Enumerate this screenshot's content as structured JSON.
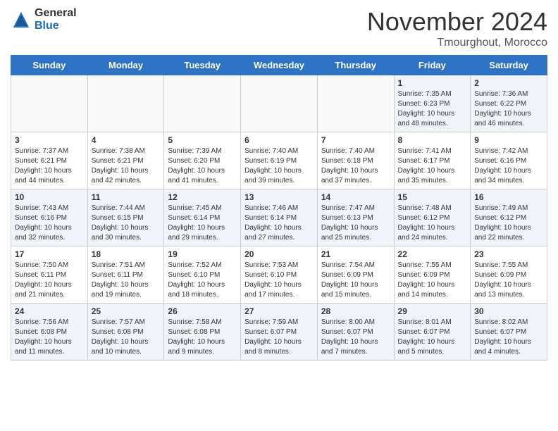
{
  "header": {
    "logo_general": "General",
    "logo_blue": "Blue",
    "month_title": "November 2024",
    "location": "Tmourghout, Morocco"
  },
  "days_of_week": [
    "Sunday",
    "Monday",
    "Tuesday",
    "Wednesday",
    "Thursday",
    "Friday",
    "Saturday"
  ],
  "weeks": [
    [
      {
        "day": "",
        "empty": true
      },
      {
        "day": "",
        "empty": true
      },
      {
        "day": "",
        "empty": true
      },
      {
        "day": "",
        "empty": true
      },
      {
        "day": "",
        "empty": true
      },
      {
        "day": "1",
        "sunrise": "7:35 AM",
        "sunset": "6:23 PM",
        "daylight": "10 hours and 48 minutes."
      },
      {
        "day": "2",
        "sunrise": "7:36 AM",
        "sunset": "6:22 PM",
        "daylight": "10 hours and 46 minutes."
      }
    ],
    [
      {
        "day": "3",
        "sunrise": "7:37 AM",
        "sunset": "6:21 PM",
        "daylight": "10 hours and 44 minutes."
      },
      {
        "day": "4",
        "sunrise": "7:38 AM",
        "sunset": "6:21 PM",
        "daylight": "10 hours and 42 minutes."
      },
      {
        "day": "5",
        "sunrise": "7:39 AM",
        "sunset": "6:20 PM",
        "daylight": "10 hours and 41 minutes."
      },
      {
        "day": "6",
        "sunrise": "7:40 AM",
        "sunset": "6:19 PM",
        "daylight": "10 hours and 39 minutes."
      },
      {
        "day": "7",
        "sunrise": "7:40 AM",
        "sunset": "6:18 PM",
        "daylight": "10 hours and 37 minutes."
      },
      {
        "day": "8",
        "sunrise": "7:41 AM",
        "sunset": "6:17 PM",
        "daylight": "10 hours and 35 minutes."
      },
      {
        "day": "9",
        "sunrise": "7:42 AM",
        "sunset": "6:16 PM",
        "daylight": "10 hours and 34 minutes."
      }
    ],
    [
      {
        "day": "10",
        "sunrise": "7:43 AM",
        "sunset": "6:16 PM",
        "daylight": "10 hours and 32 minutes."
      },
      {
        "day": "11",
        "sunrise": "7:44 AM",
        "sunset": "6:15 PM",
        "daylight": "10 hours and 30 minutes."
      },
      {
        "day": "12",
        "sunrise": "7:45 AM",
        "sunset": "6:14 PM",
        "daylight": "10 hours and 29 minutes."
      },
      {
        "day": "13",
        "sunrise": "7:46 AM",
        "sunset": "6:14 PM",
        "daylight": "10 hours and 27 minutes."
      },
      {
        "day": "14",
        "sunrise": "7:47 AM",
        "sunset": "6:13 PM",
        "daylight": "10 hours and 25 minutes."
      },
      {
        "day": "15",
        "sunrise": "7:48 AM",
        "sunset": "6:12 PM",
        "daylight": "10 hours and 24 minutes."
      },
      {
        "day": "16",
        "sunrise": "7:49 AM",
        "sunset": "6:12 PM",
        "daylight": "10 hours and 22 minutes."
      }
    ],
    [
      {
        "day": "17",
        "sunrise": "7:50 AM",
        "sunset": "6:11 PM",
        "daylight": "10 hours and 21 minutes."
      },
      {
        "day": "18",
        "sunrise": "7:51 AM",
        "sunset": "6:11 PM",
        "daylight": "10 hours and 19 minutes."
      },
      {
        "day": "19",
        "sunrise": "7:52 AM",
        "sunset": "6:10 PM",
        "daylight": "10 hours and 18 minutes."
      },
      {
        "day": "20",
        "sunrise": "7:53 AM",
        "sunset": "6:10 PM",
        "daylight": "10 hours and 17 minutes."
      },
      {
        "day": "21",
        "sunrise": "7:54 AM",
        "sunset": "6:09 PM",
        "daylight": "10 hours and 15 minutes."
      },
      {
        "day": "22",
        "sunrise": "7:55 AM",
        "sunset": "6:09 PM",
        "daylight": "10 hours and 14 minutes."
      },
      {
        "day": "23",
        "sunrise": "7:55 AM",
        "sunset": "6:09 PM",
        "daylight": "10 hours and 13 minutes."
      }
    ],
    [
      {
        "day": "24",
        "sunrise": "7:56 AM",
        "sunset": "6:08 PM",
        "daylight": "10 hours and 11 minutes."
      },
      {
        "day": "25",
        "sunrise": "7:57 AM",
        "sunset": "6:08 PM",
        "daylight": "10 hours and 10 minutes."
      },
      {
        "day": "26",
        "sunrise": "7:58 AM",
        "sunset": "6:08 PM",
        "daylight": "10 hours and 9 minutes."
      },
      {
        "day": "27",
        "sunrise": "7:59 AM",
        "sunset": "6:07 PM",
        "daylight": "10 hours and 8 minutes."
      },
      {
        "day": "28",
        "sunrise": "8:00 AM",
        "sunset": "6:07 PM",
        "daylight": "10 hours and 7 minutes."
      },
      {
        "day": "29",
        "sunrise": "8:01 AM",
        "sunset": "6:07 PM",
        "daylight": "10 hours and 5 minutes."
      },
      {
        "day": "30",
        "sunrise": "8:02 AM",
        "sunset": "6:07 PM",
        "daylight": "10 hours and 4 minutes."
      }
    ]
  ]
}
